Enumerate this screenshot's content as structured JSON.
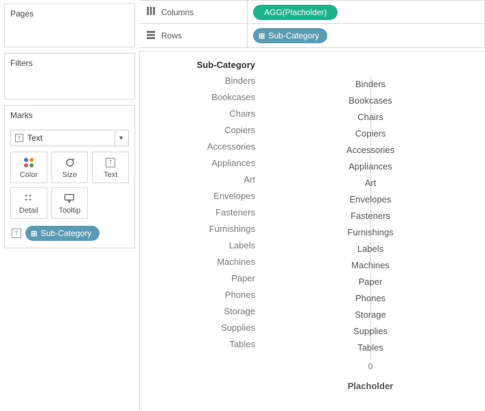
{
  "panels": {
    "pages": "Pages",
    "filters": "Filters",
    "marks": "Marks"
  },
  "marks": {
    "type": "Text",
    "buttons": {
      "color": "Color",
      "size": "Size",
      "text": "Text",
      "detail": "Detail",
      "tooltip": "Tooltip"
    },
    "assigned_pill": "Sub-Category"
  },
  "shelves": {
    "columns_label": "Columns",
    "rows_label": "Rows",
    "columns_pill": "AGG(Placholder)",
    "rows_pill": "Sub-Category"
  },
  "viz": {
    "header_title": "Sub-Category",
    "rows": [
      "Binders",
      "Bookcases",
      "Chairs",
      "Copiers",
      "Accessories",
      "Appliances",
      "Art",
      "Envelopes",
      "Fasteners",
      "Furnishings",
      "Labels",
      "Machines",
      "Paper",
      "Phones",
      "Storage",
      "Supplies",
      "Tables"
    ],
    "tick_zero": "0",
    "axis_title": "Placholder"
  }
}
